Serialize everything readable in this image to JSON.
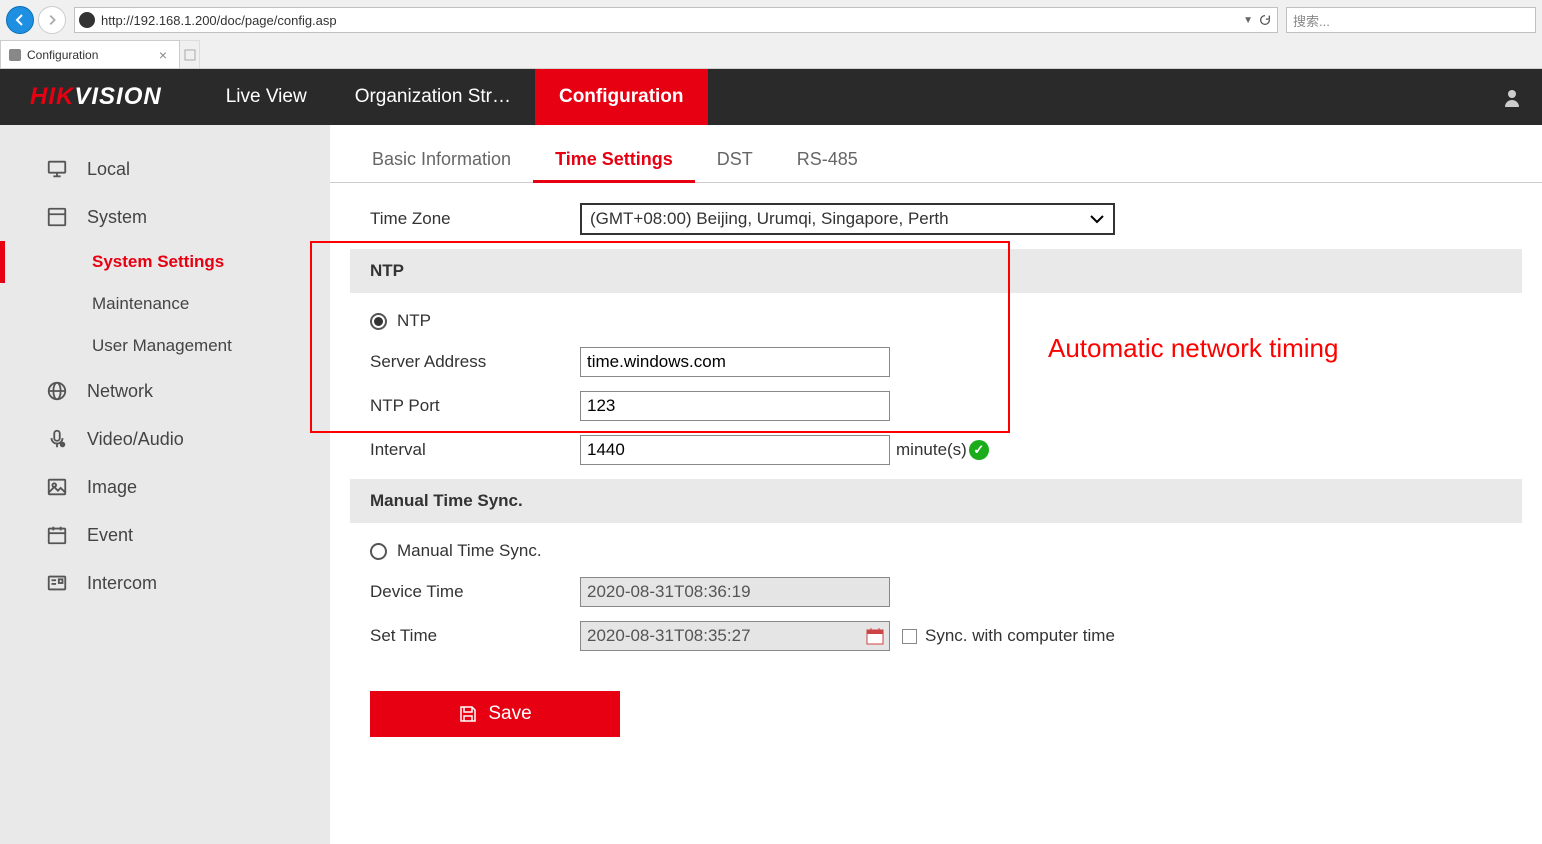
{
  "browser": {
    "url": "http://192.168.1.200/doc/page/config.asp",
    "search_placeholder": "搜索...",
    "tab_title": "Configuration"
  },
  "logo": {
    "part1": "HIK",
    "part2": "VISION"
  },
  "main_nav": {
    "live": "Live View",
    "org": "Organization Str…",
    "config": "Configuration"
  },
  "sidebar": {
    "local": "Local",
    "system": "System",
    "system_settings": "System Settings",
    "maintenance": "Maintenance",
    "user_management": "User Management",
    "network": "Network",
    "video_audio": "Video/Audio",
    "image": "Image",
    "event": "Event",
    "intercom": "Intercom"
  },
  "subtabs": {
    "basic": "Basic Information",
    "time": "Time Settings",
    "dst": "DST",
    "rs485": "RS-485"
  },
  "form": {
    "timezone_label": "Time Zone",
    "timezone_value": "(GMT+08:00) Beijing, Urumqi, Singapore, Perth",
    "ntp_section": "NTP",
    "ntp_radio": "NTP",
    "server_address_label": "Server Address",
    "server_address_value": "time.windows.com",
    "ntp_port_label": "NTP Port",
    "ntp_port_value": "123",
    "interval_label": "Interval",
    "interval_value": "1440",
    "interval_unit": "minute(s)",
    "manual_section": "Manual Time Sync.",
    "manual_radio": "Manual Time Sync.",
    "device_time_label": "Device Time",
    "device_time_value": "2020-08-31T08:36:19",
    "set_time_label": "Set Time",
    "set_time_value": "2020-08-31T08:35:27",
    "sync_computer": "Sync. with computer time",
    "save": "Save"
  },
  "annotation": "Automatic network timing"
}
